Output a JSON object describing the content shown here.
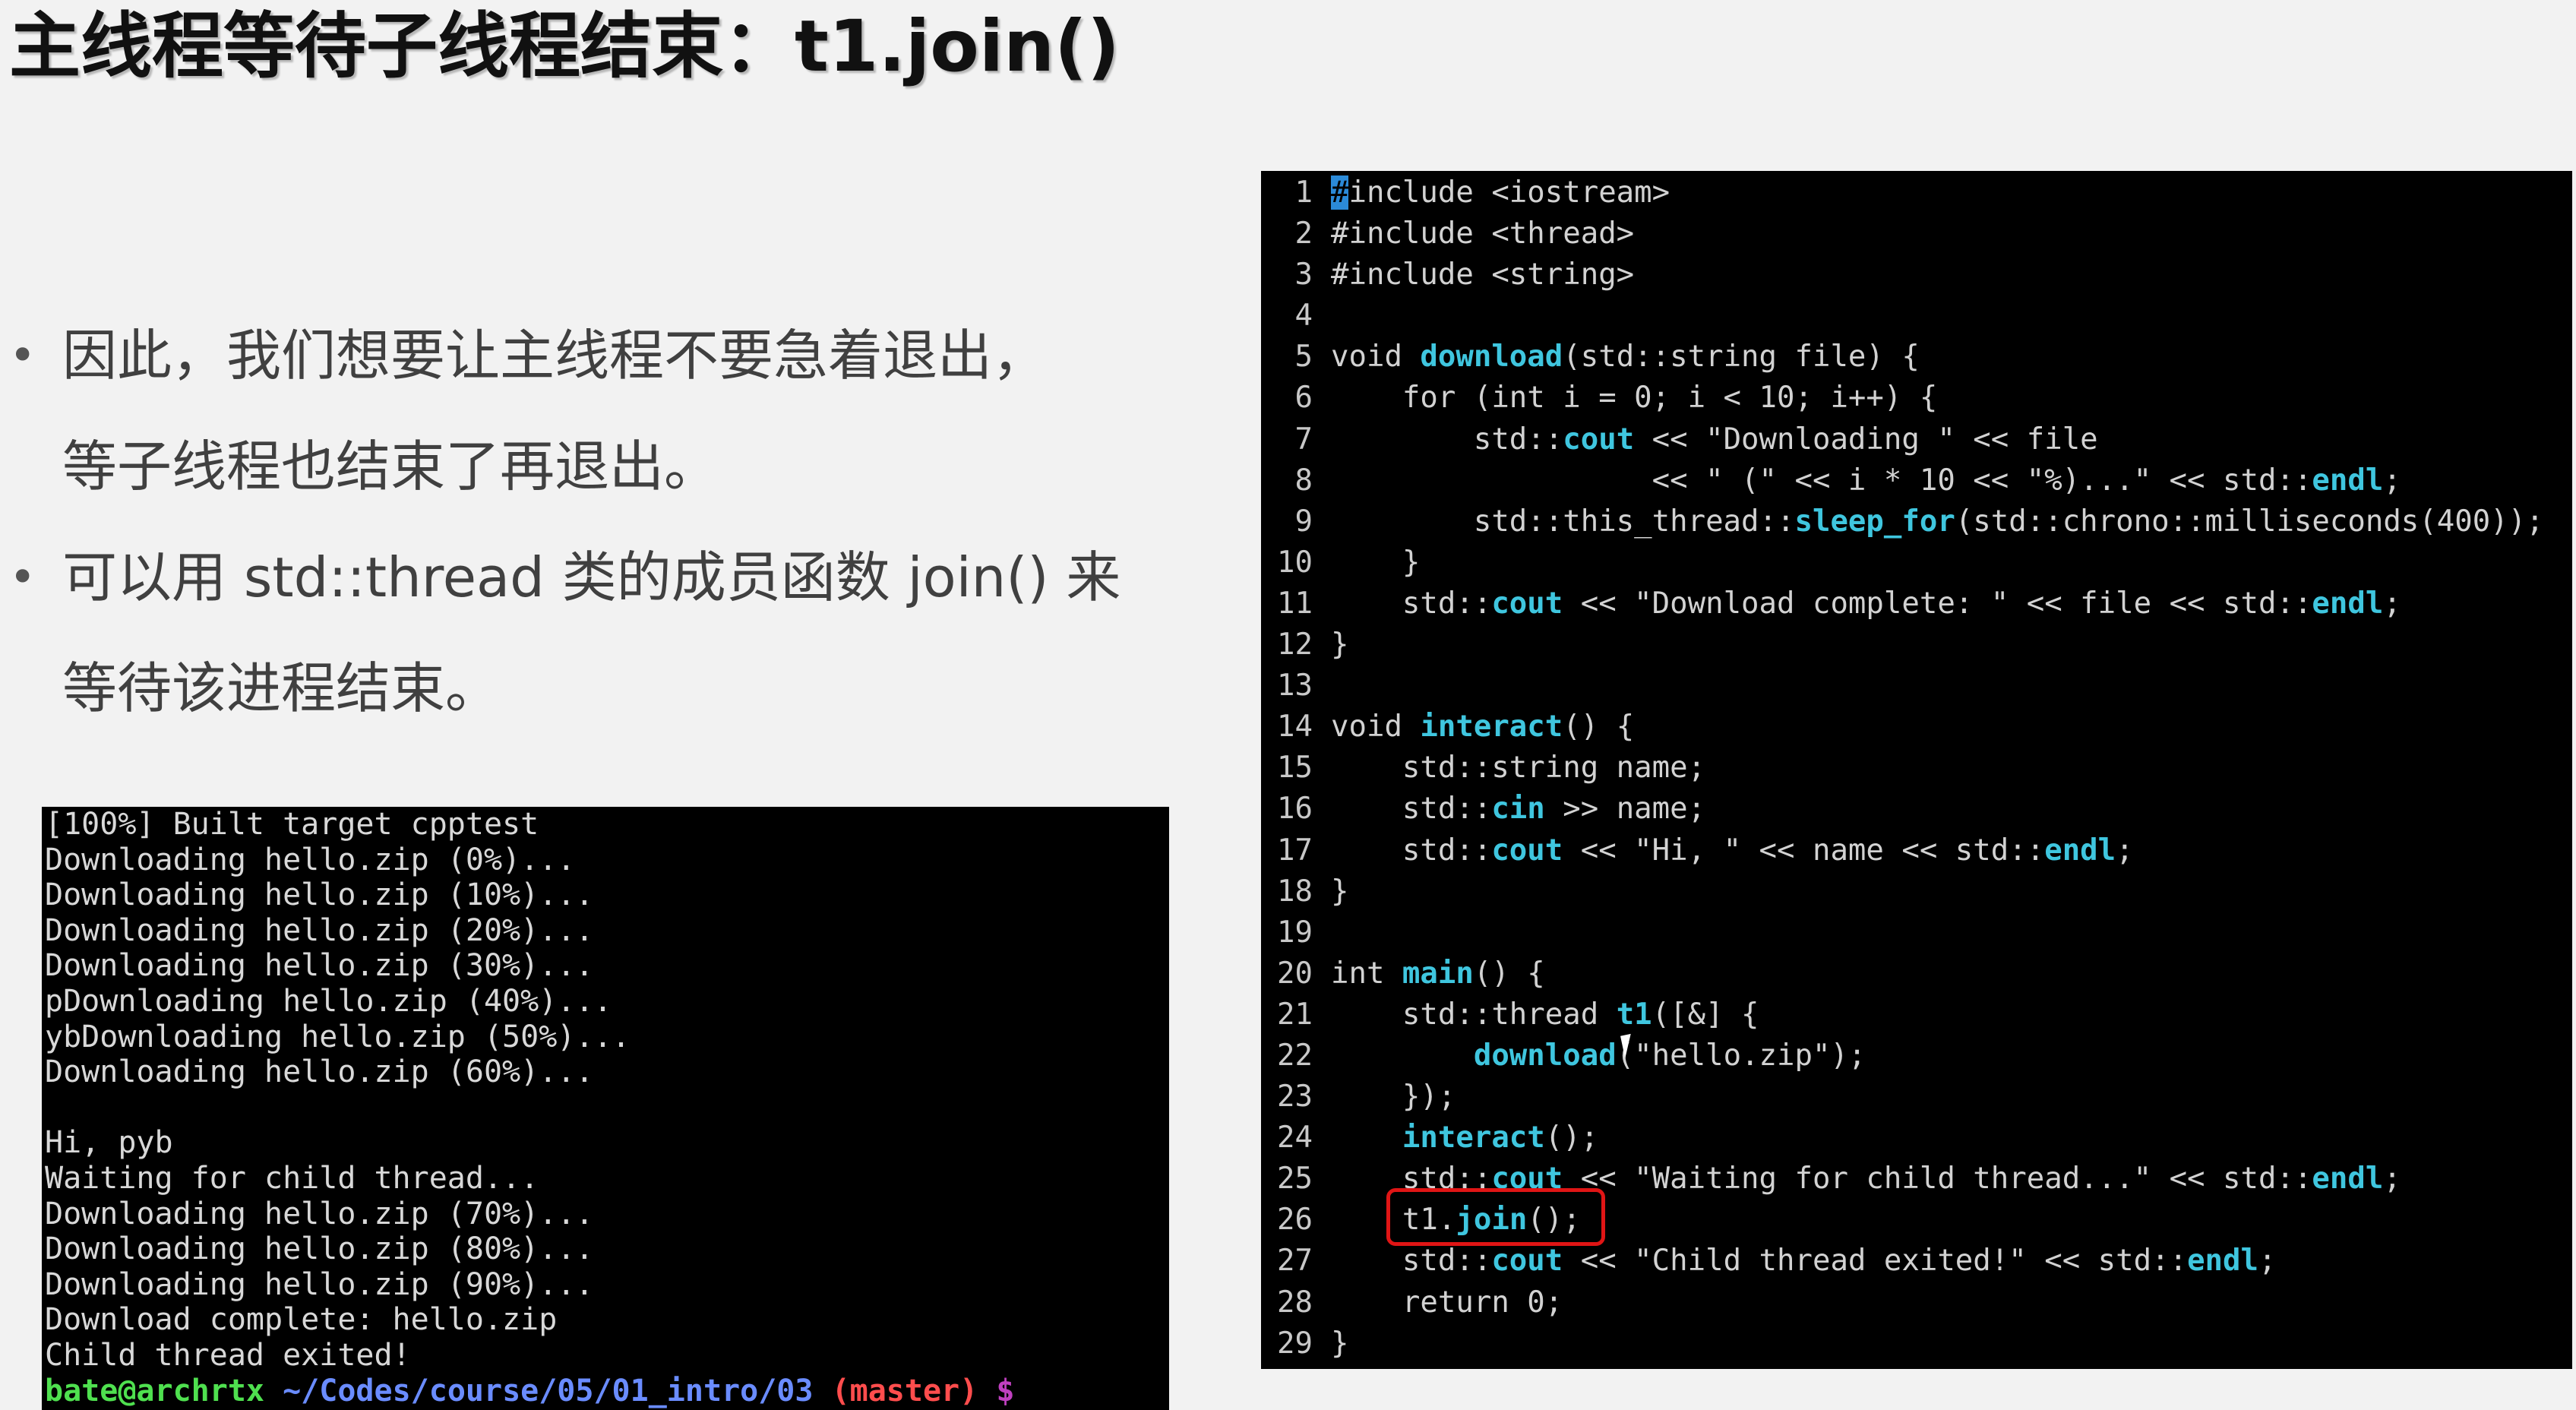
{
  "slide": {
    "title": "主线程等待子线程结束：t1.join()",
    "bullets": [
      [
        "因此，我们想要让主线程不要急着退出，",
        "等子线程也结束了再退出。"
      ],
      [
        "可以用 std::thread 类的成员函数 join() 来",
        "等待该进程结束。"
      ]
    ],
    "bullet_symbol": "•"
  },
  "terminal": {
    "lines": [
      "[100%] Built target cpptest",
      "Downloading hello.zip (0%)...",
      "Downloading hello.zip (10%)...",
      "Downloading hello.zip (20%)...",
      "Downloading hello.zip (30%)...",
      "pDownloading hello.zip (40%)...",
      "ybDownloading hello.zip (50%)...",
      "Downloading hello.zip (60%)...",
      "",
      "Hi, pyb",
      "Waiting for child thread...",
      "Downloading hello.zip (70%)...",
      "Downloading hello.zip (80%)...",
      "Downloading hello.zip (90%)...",
      "Download complete: hello.zip",
      "Child thread exited!"
    ],
    "prompt": {
      "user": "bate@archrtx",
      "path": "~/Codes/course/05/01_intro/03",
      "branch": "(master)",
      "symbol": "$"
    },
    "colors": {
      "background": "#000000",
      "text": "#d8d8d8",
      "user": "#4fe04f",
      "path": "#6a8cff",
      "branch": "#ff4d4d"
    }
  },
  "editor": {
    "highlighted_line": 26,
    "highlight_color": "#e01515",
    "accent_color": "#3fc6df",
    "lines": [
      {
        "n": "1",
        "seg": [
          [
            "cur",
            "#"
          ],
          [
            "p",
            "include <iostream>"
          ]
        ]
      },
      {
        "n": "2",
        "seg": [
          [
            "p",
            "#include <thread>"
          ]
        ]
      },
      {
        "n": "3",
        "seg": [
          [
            "p",
            "#include <string>"
          ]
        ]
      },
      {
        "n": "4",
        "seg": []
      },
      {
        "n": "5",
        "seg": [
          [
            "p",
            "void "
          ],
          [
            "fn",
            "download"
          ],
          [
            "p",
            "(std::string file) {"
          ]
        ]
      },
      {
        "n": "6",
        "seg": [
          [
            "p",
            "    for (int i = 0; i < 10; i++) {"
          ]
        ]
      },
      {
        "n": "7",
        "seg": [
          [
            "p",
            "        std::"
          ],
          [
            "fn",
            "cout"
          ],
          [
            "p",
            " << \"Downloading \" << file"
          ]
        ]
      },
      {
        "n": "8",
        "seg": [
          [
            "p",
            "                  << \" (\" << i * 10 << \"%)...\" << std::"
          ],
          [
            "fn",
            "endl"
          ],
          [
            "p",
            ";"
          ]
        ]
      },
      {
        "n": "9",
        "seg": [
          [
            "p",
            "        std::this_thread::"
          ],
          [
            "fn",
            "sleep_for"
          ],
          [
            "p",
            "(std::chrono::milliseconds(400));"
          ]
        ]
      },
      {
        "n": "10",
        "seg": [
          [
            "p",
            "    }"
          ]
        ]
      },
      {
        "n": "11",
        "seg": [
          [
            "p",
            "    std::"
          ],
          [
            "fn",
            "cout"
          ],
          [
            "p",
            " << \"Download complete: \" << file << std::"
          ],
          [
            "fn",
            "endl"
          ],
          [
            "p",
            ";"
          ]
        ]
      },
      {
        "n": "12",
        "seg": [
          [
            "p",
            "}"
          ]
        ]
      },
      {
        "n": "13",
        "seg": []
      },
      {
        "n": "14",
        "seg": [
          [
            "p",
            "void "
          ],
          [
            "fn",
            "interact"
          ],
          [
            "p",
            "() {"
          ]
        ]
      },
      {
        "n": "15",
        "seg": [
          [
            "p",
            "    std::string name;"
          ]
        ]
      },
      {
        "n": "16",
        "seg": [
          [
            "p",
            "    std::"
          ],
          [
            "fn",
            "cin"
          ],
          [
            "p",
            " >> name;"
          ]
        ]
      },
      {
        "n": "17",
        "seg": [
          [
            "p",
            "    std::"
          ],
          [
            "fn",
            "cout"
          ],
          [
            "p",
            " << \"Hi, \" << name << std::"
          ],
          [
            "fn",
            "endl"
          ],
          [
            "p",
            ";"
          ]
        ]
      },
      {
        "n": "18",
        "seg": [
          [
            "p",
            "}"
          ]
        ]
      },
      {
        "n": "19",
        "seg": []
      },
      {
        "n": "20",
        "seg": [
          [
            "p",
            "int "
          ],
          [
            "fn",
            "main"
          ],
          [
            "p",
            "() {"
          ]
        ]
      },
      {
        "n": "21",
        "seg": [
          [
            "p",
            "    std::thread "
          ],
          [
            "fn",
            "t1"
          ],
          [
            "p",
            "([&] {"
          ]
        ]
      },
      {
        "n": "22",
        "seg": [
          [
            "p",
            "        "
          ],
          [
            "fn",
            "download"
          ],
          [
            "p",
            "(\"hello.zip\");"
          ]
        ]
      },
      {
        "n": "23",
        "seg": [
          [
            "p",
            "    });"
          ]
        ]
      },
      {
        "n": "24",
        "seg": [
          [
            "p",
            "    "
          ],
          [
            "fn",
            "interact"
          ],
          [
            "p",
            "();"
          ]
        ]
      },
      {
        "n": "25",
        "seg": [
          [
            "p",
            "    std::"
          ],
          [
            "fn",
            "cout"
          ],
          [
            "p",
            " << \"Waiting for child thread...\" << std::"
          ],
          [
            "fn",
            "endl"
          ],
          [
            "p",
            ";"
          ]
        ]
      },
      {
        "n": "26",
        "seg": [
          [
            "p",
            "    t1."
          ],
          [
            "fn",
            "join"
          ],
          [
            "p",
            "();"
          ]
        ]
      },
      {
        "n": "27",
        "seg": [
          [
            "p",
            "    std::"
          ],
          [
            "fn",
            "cout"
          ],
          [
            "p",
            " << \"Child thread exited!\" << std::"
          ],
          [
            "fn",
            "endl"
          ],
          [
            "p",
            ";"
          ]
        ]
      },
      {
        "n": "28",
        "seg": [
          [
            "p",
            "    return 0;"
          ]
        ]
      },
      {
        "n": "29",
        "seg": [
          [
            "p",
            "}"
          ]
        ]
      }
    ]
  }
}
